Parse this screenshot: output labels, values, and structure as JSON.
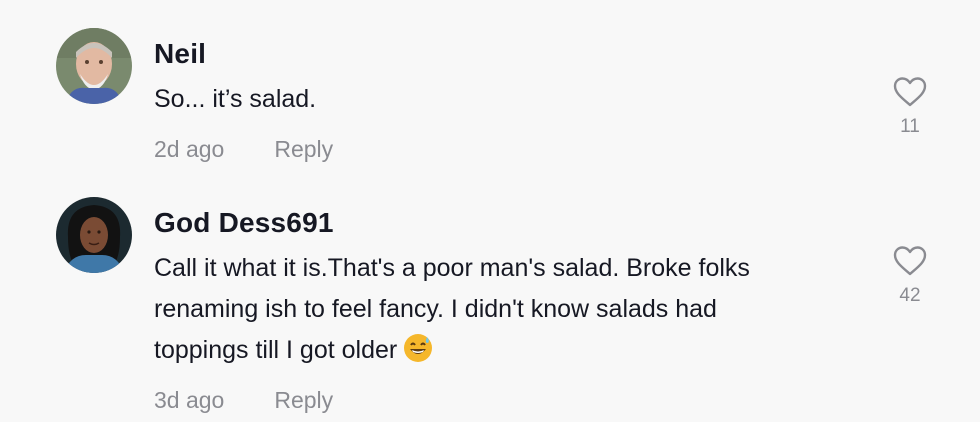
{
  "comments": [
    {
      "username": "Neil",
      "text_lines": [
        "So... it’s salad."
      ],
      "time": "2d ago",
      "reply_label": "Reply",
      "like_count": "11",
      "avatar_icon": "avatar-photo-neil"
    },
    {
      "username": "God Dess691",
      "text_lines": [
        "Call it what it is.That's a poor man's salad. Broke folks",
        "renaming ish to feel fancy. I didn't know salads had",
        "toppings till I got older"
      ],
      "emoji": "😅",
      "time": "3d ago",
      "reply_label": "Reply",
      "like_count": "42",
      "avatar_icon": "avatar-photo-goddess"
    }
  ],
  "colors": {
    "background": "#f8f8f8",
    "text": "#161823",
    "secondary": "#8a8b91",
    "emoji": "#f5b72b"
  },
  "icons": {
    "like": "heart-outline-icon"
  }
}
